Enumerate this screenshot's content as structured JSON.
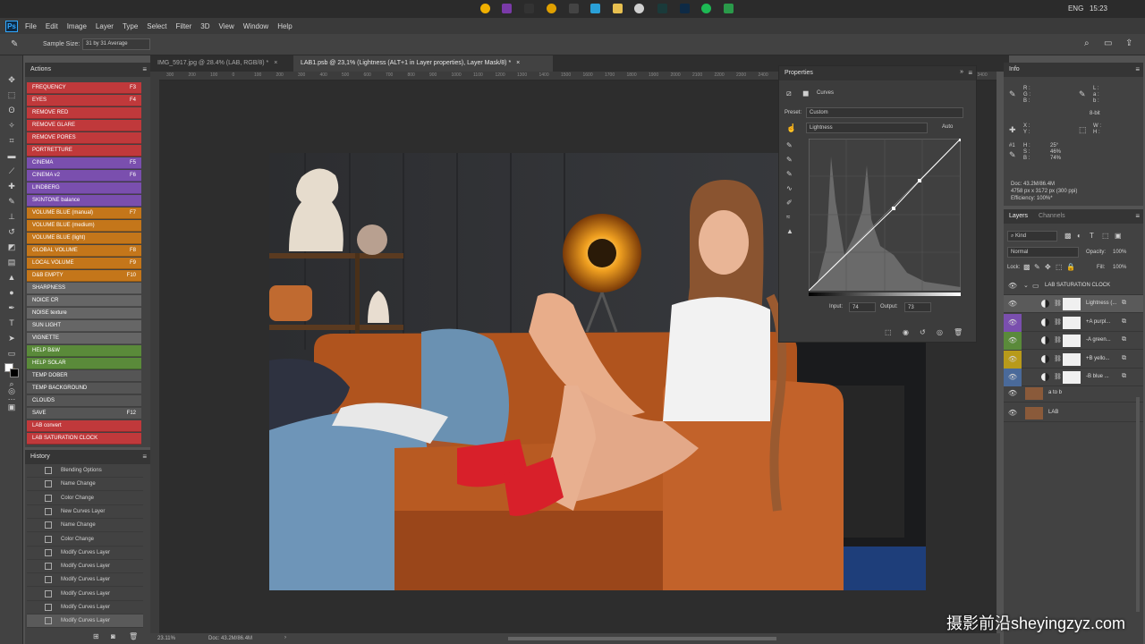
{
  "taskbar": {
    "lang": "ENG",
    "time": "15:23"
  },
  "menubar": {
    "logo": "Ps",
    "items": [
      "File",
      "Edit",
      "Image",
      "Layer",
      "Type",
      "Select",
      "Filter",
      "3D",
      "View",
      "Window",
      "Help"
    ]
  },
  "options": {
    "sample_size_label": "Sample Size:",
    "sample_size_value": "31 by 31 Average"
  },
  "actions": {
    "title": "Actions",
    "items": [
      {
        "label": "FREQUENCY",
        "key": "F3",
        "color": "#c0393b"
      },
      {
        "label": "EYES",
        "key": "F4",
        "color": "#c0393b"
      },
      {
        "label": "REMOVE RED",
        "key": "",
        "color": "#c0393b"
      },
      {
        "label": "REMOVE GLARE",
        "key": "",
        "color": "#c0393b"
      },
      {
        "label": "REMOVE PORES",
        "key": "",
        "color": "#c0393b"
      },
      {
        "label": "PORTRETTURE",
        "key": "",
        "color": "#c0393b"
      },
      {
        "label": "CINEMA",
        "key": "F5",
        "color": "#7a4fae"
      },
      {
        "label": "CINEMA v2",
        "key": "F6",
        "color": "#7a4fae"
      },
      {
        "label": "LINDBERG",
        "key": "",
        "color": "#7a4fae"
      },
      {
        "label": "SKINTONE balance",
        "key": "",
        "color": "#7a4fae"
      },
      {
        "label": "VOLUME BLUE (manual)",
        "key": "F7",
        "color": "#c4761a"
      },
      {
        "label": "VOLUME BLUE (medium)",
        "key": "",
        "color": "#c4761a"
      },
      {
        "label": "VOLUME BLUE (light)",
        "key": "",
        "color": "#c4761a"
      },
      {
        "label": "GLOBAL VOLUME",
        "key": "F8",
        "color": "#c4761a"
      },
      {
        "label": "LOCAL VOLUME",
        "key": "F9",
        "color": "#c4761a"
      },
      {
        "label": "D&B EMPTY",
        "key": "F10",
        "color": "#c4761a"
      },
      {
        "label": "SHARPNESS",
        "key": "",
        "color": "#666666"
      },
      {
        "label": "NOICE CR",
        "key": "",
        "color": "#666666"
      },
      {
        "label": "NOISE texture",
        "key": "",
        "color": "#666666"
      },
      {
        "label": "SUN LIGHT",
        "key": "",
        "color": "#666666"
      },
      {
        "label": "VIGNETTE",
        "key": "",
        "color": "#666666"
      },
      {
        "label": "HELP B&W",
        "key": "",
        "color": "#5a8a3a"
      },
      {
        "label": "HELP SOLAR",
        "key": "",
        "color": "#5a8a3a"
      },
      {
        "label": "TEMP DOBER",
        "key": "",
        "color": "#555555"
      },
      {
        "label": "TEMP BACKGROUND",
        "key": "",
        "color": "#555555"
      },
      {
        "label": "CLOUDS",
        "key": "",
        "color": "#555555"
      },
      {
        "label": "SAVE",
        "key": "F12",
        "color": "#555555"
      },
      {
        "label": "LAB convert",
        "key": "",
        "color": "#c0393b"
      },
      {
        "label": "LAB SATURATION CLOCK",
        "key": "",
        "color": "#c0393b"
      }
    ]
  },
  "history": {
    "title": "History",
    "items": [
      "Blending Options",
      "Name Change",
      "Color Change",
      "New Curves Layer",
      "Name Change",
      "Color Change",
      "Modify Curves Layer",
      "Modify Curves Layer",
      "Modify Curves Layer",
      "Modify Curves Layer",
      "Modify Curves Layer",
      "Modify Curves Layer"
    ]
  },
  "doc_tabs": [
    {
      "label": "IMG_5917.jpg @ 28.4% (LAB, RGB/8) *",
      "active": false
    },
    {
      "label": "LAB1.psb @ 23,1% (Lightness    (ALT+1 in Layer properties), Layer Mask/8) *",
      "active": true
    }
  ],
  "ruler_ticks": [
    "300",
    "200",
    "100",
    "0",
    "100",
    "200",
    "300",
    "400",
    "500",
    "600",
    "700",
    "800",
    "900",
    "1000",
    "1100",
    "1200",
    "1300",
    "1400",
    "1500",
    "1600",
    "1700",
    "1800",
    "1900",
    "2000",
    "2100",
    "2200",
    "2300",
    "2400",
    "2500",
    "2600",
    "2700",
    "2800",
    "2900",
    "3000",
    "3100",
    "3200",
    "3300",
    "3400"
  ],
  "status": {
    "zoom": "23.11%",
    "doc": "Doc: 43.2M/86.4M"
  },
  "properties": {
    "title": "Properties",
    "type": "Curves",
    "preset_label": "Preset:",
    "preset_value": "Custom",
    "channel": "Lightness",
    "auto_label": "Auto",
    "input_label": "Input:",
    "input_value": "74",
    "output_label": "Output:",
    "output_value": "73"
  },
  "info": {
    "title": "Info",
    "rgb_labels": [
      "R :",
      "G :",
      "B :"
    ],
    "lab_labels": [
      "L :",
      "a :",
      "b :"
    ],
    "bit": "8-bit",
    "xy_labels": [
      "X :",
      "Y :"
    ],
    "wh_labels": [
      "W :",
      "H :"
    ],
    "hsb_labels": [
      "H :",
      "S :",
      "B :"
    ],
    "hsb_values": [
      "25°",
      "46%",
      "74%"
    ],
    "sample_id": "#1",
    "doc_line": "Doc: 43.2M/86.4M",
    "size_line": "4758 px x 3172 px (300 ppi)",
    "eff_line": "Efficiency: 100%*"
  },
  "layers": {
    "tabs": [
      "Layers",
      "Channels"
    ],
    "kind": "Kind",
    "blend": "Normal",
    "opacity_label": "Opacity:",
    "opacity": "100%",
    "lock_label": "Lock:",
    "fill_label": "Fill:",
    "fill": "100%",
    "group": "LAB SATURATION CLOCK",
    "items": [
      {
        "name": "Lightness  (...",
        "color": "",
        "selected": true
      },
      {
        "name": "+A purpl...",
        "color": "#7a4fae",
        "selected": false
      },
      {
        "name": "-A green...",
        "color": "#5a8a3a",
        "selected": false
      },
      {
        "name": "+B yello...",
        "color": "#b89a1a",
        "selected": false
      },
      {
        "name": "-B blue ...",
        "color": "#4a6a9a",
        "selected": false
      }
    ],
    "base": [
      "a to b",
      "LAB"
    ]
  },
  "watermark": {
    "cn": "摄影前沿",
    "url": "sheyingzyz.com"
  }
}
